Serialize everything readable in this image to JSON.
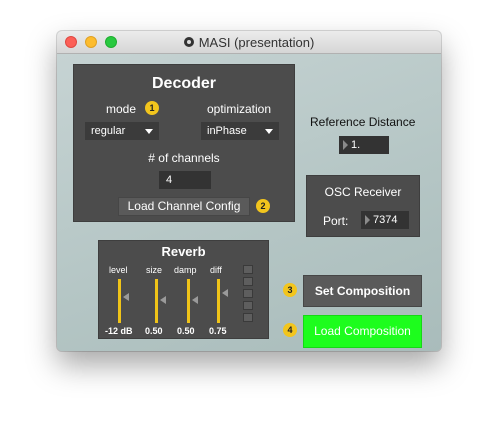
{
  "window": {
    "title": "MASI (presentation)",
    "icon": "max-patch-icon"
  },
  "decoder": {
    "title": "Decoder",
    "mode_label": "mode",
    "mode_badge": "1",
    "mode_value": "regular",
    "optimization_label": "optimization",
    "optimization_value": "inPhase",
    "channels_label": "# of channels",
    "channels_value": "4",
    "load_config_label": "Load Channel Config",
    "load_config_badge": "2"
  },
  "reference": {
    "label": "Reference Distance",
    "value": "1."
  },
  "osc": {
    "title": "OSC Receiver",
    "port_label": "Port:",
    "port_value": "7374"
  },
  "reverb": {
    "title": "Reverb",
    "params": [
      {
        "label": "level",
        "value": "-12 dB",
        "level": 0.55
      },
      {
        "label": "size",
        "value": "0.50",
        "level": 0.5
      },
      {
        "label": "damp",
        "value": "0.50",
        "level": 0.5
      },
      {
        "label": "diff",
        "value": "0.75",
        "level": 0.75
      }
    ]
  },
  "actions": {
    "set_badge": "3",
    "set_label": "Set Composition",
    "load_badge": "4",
    "load_label": "Load Composition"
  },
  "colors": {
    "accent_yellow": "#f2c51d",
    "load_green": "#1dfd1d",
    "panel": "#4c4c4c"
  }
}
